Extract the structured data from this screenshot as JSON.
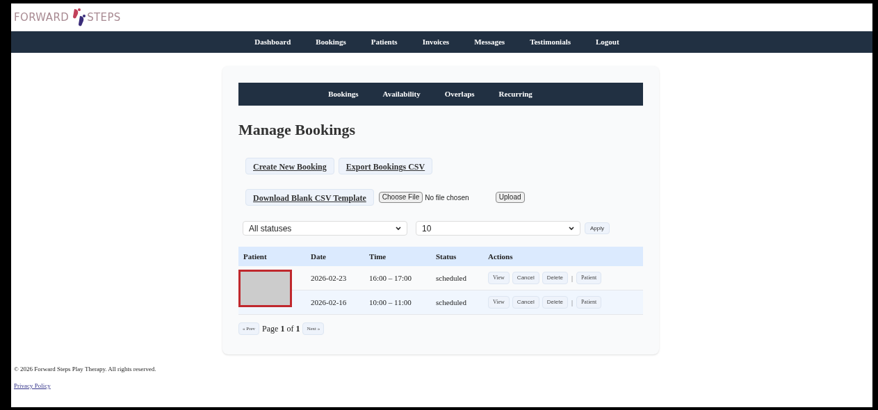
{
  "logo": {
    "left": "FORWARD",
    "right": "STEPS"
  },
  "nav": [
    {
      "label": "Dashboard"
    },
    {
      "label": "Bookings"
    },
    {
      "label": "Patients"
    },
    {
      "label": "Invoices"
    },
    {
      "label": "Messages"
    },
    {
      "label": "Testimonials"
    },
    {
      "label": "Logout"
    }
  ],
  "subnav": [
    {
      "label": "Bookings"
    },
    {
      "label": "Availability"
    },
    {
      "label": "Overlaps"
    },
    {
      "label": "Recurring"
    }
  ],
  "heading": "Manage Bookings",
  "actions": [
    "Create New Booking",
    "Export Bookings CSV"
  ],
  "template_link": "Download Blank CSV Template",
  "file_input": {
    "button": "Choose File",
    "value": "No file chosen"
  },
  "upload_button": "Upload",
  "filters": {
    "status": "All statuses",
    "per_page": "10",
    "apply": "Apply"
  },
  "table": {
    "columns": [
      "Patient",
      "Date",
      "Time",
      "Status",
      "Actions"
    ],
    "patient_redacted": true,
    "rows": [
      {
        "date": "2026-02-23",
        "time": "16:00 – 17:00",
        "status": "scheduled",
        "actions": [
          "View",
          "Cancel",
          "Delete"
        ],
        "separator": "|",
        "patient_button": "Patient"
      },
      {
        "date": "2026-02-16",
        "time": "10:00 – 11:00",
        "status": "scheduled",
        "actions": [
          "View",
          "Cancel",
          "Delete"
        ],
        "separator": "|",
        "patient_button": "Patient"
      }
    ]
  },
  "pagination": {
    "prev": "« Prev",
    "page": "Page **1** of **1**",
    "next": "Next »"
  },
  "footer": {
    "copyright": "© 2026 Forward Steps Play Therapy. All rights reserved.",
    "privacy": "Privacy Policy"
  }
}
